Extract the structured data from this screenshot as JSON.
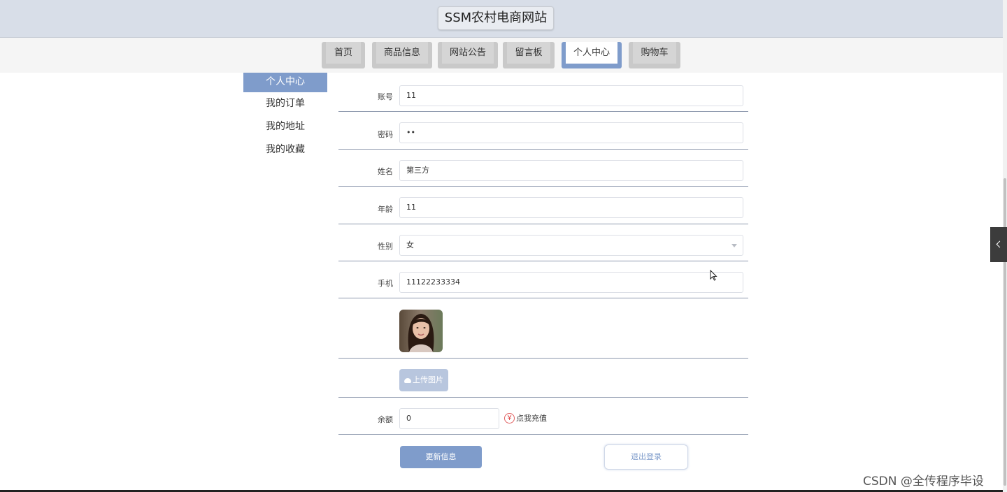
{
  "site": {
    "title": "SSM农村电商网站"
  },
  "nav": {
    "items": [
      {
        "label": "首页"
      },
      {
        "label": "商品信息"
      },
      {
        "label": "网站公告"
      },
      {
        "label": "留言板"
      },
      {
        "label": "个人中心"
      },
      {
        "label": "购物车"
      }
    ],
    "active": "个人中心"
  },
  "sidebar": {
    "items": [
      {
        "label": "个人中心"
      },
      {
        "label": "我的订单"
      },
      {
        "label": "我的地址"
      },
      {
        "label": "我的收藏"
      }
    ]
  },
  "form": {
    "account": {
      "label": "账号",
      "value": "11"
    },
    "password": {
      "label": "密码",
      "value": "••"
    },
    "name": {
      "label": "姓名",
      "value": "第三方"
    },
    "age": {
      "label": "年龄",
      "value": "11"
    },
    "gender": {
      "label": "性别",
      "value": "女"
    },
    "phone": {
      "label": "手机",
      "value": "11122233334"
    },
    "upload_label": "上传图片",
    "balance": {
      "label": "余额",
      "value": "0"
    },
    "recharge_label": "点我充值",
    "recharge_icon": "¥"
  },
  "actions": {
    "update_label": "更新信息",
    "logout_label": "退出登录"
  },
  "watermark": "CSDN @全传程序毕设",
  "colors": {
    "accent": "#7f9ccb",
    "header_bg": "#d8dee8"
  }
}
